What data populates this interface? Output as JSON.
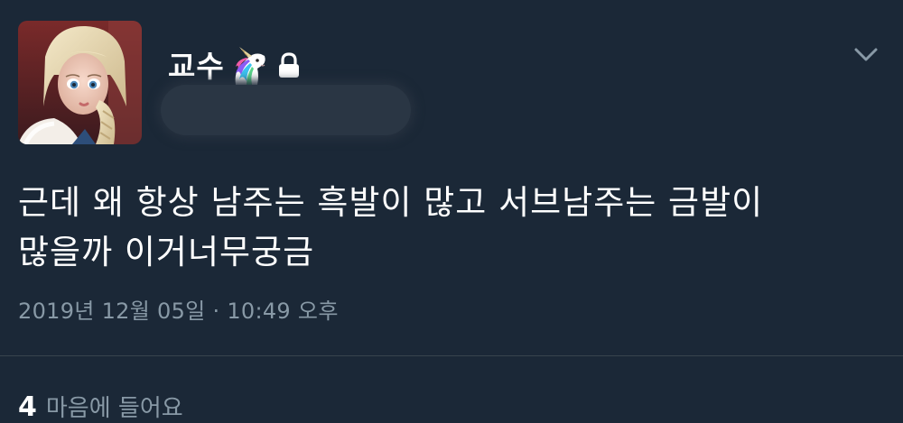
{
  "tweet": {
    "display_name": "교수",
    "display_name_emoji": "unicorn-icon",
    "protected_icon": "lock-icon",
    "handle_redacted": true,
    "menu_icon": "chevron-down-icon",
    "text": "근데 왜 항상 남주는 흑발이 많고 서브남주는 금발이\n많을까 이거너무궁금",
    "timestamp": "2019년 12월 05일 · 10:49 오후",
    "likes_count": "4",
    "likes_label": "마음에 들어요"
  },
  "colors": {
    "background": "#1b2837",
    "text_primary": "#ffffff",
    "text_secondary": "#8899a6",
    "divider": "#38444d"
  }
}
